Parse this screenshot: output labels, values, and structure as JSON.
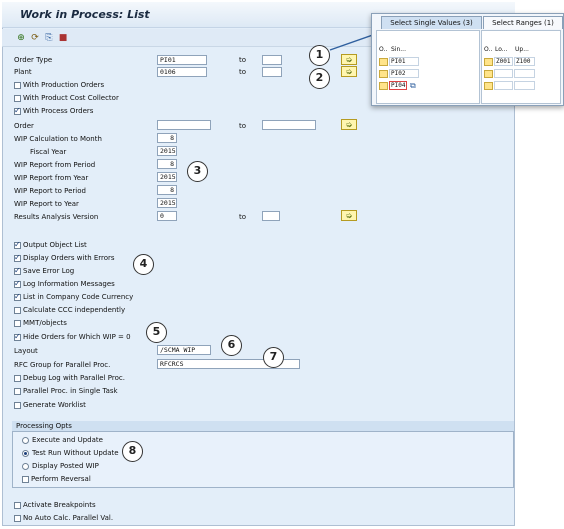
{
  "window": {
    "title": "Work in Process: List"
  },
  "toolbar": {
    "icons": [
      "execute-icon",
      "get-variant-icon",
      "save-variant-icon",
      "info-icon"
    ]
  },
  "selection": {
    "order_type": {
      "label": "Order Type",
      "from": "PI01",
      "to_label": "to",
      "to": ""
    },
    "plant": {
      "label": "Plant",
      "from": "0106",
      "to_label": "to",
      "to": ""
    },
    "with_production_orders": {
      "label": "With Production Orders",
      "checked": false
    },
    "with_product_cost_collector": {
      "label": "With Product Cost Collector",
      "checked": false
    },
    "with_process_orders": {
      "label": "With Process Orders",
      "checked": true
    },
    "order": {
      "label": "Order",
      "from": "",
      "to_label": "to",
      "to": ""
    },
    "wip_calc_month": {
      "label": "WIP Calculation to Month",
      "value": "8"
    },
    "fiscal_year": {
      "label": "Fiscal Year",
      "value": "2015"
    },
    "wip_from_period": {
      "label": "WIP Report from Period",
      "value": "8"
    },
    "wip_from_year": {
      "label": "WIP Report from Year",
      "value": "2015"
    },
    "wip_to_period": {
      "label": "WIP Report to Period",
      "value": "8"
    },
    "wip_to_year": {
      "label": "WIP Report to Year",
      "value": "2015"
    },
    "results_analysis_version": {
      "label": "Results Analysis Version",
      "value": "0",
      "to_label": "to",
      "to": ""
    }
  },
  "options": [
    {
      "label": "Output Object List",
      "checked": true
    },
    {
      "label": "Display Orders with Errors",
      "checked": true
    },
    {
      "label": "Save Error Log",
      "checked": true
    },
    {
      "label": "Log Information Messages",
      "checked": true
    },
    {
      "label": "List in Company Code Currency",
      "checked": true
    },
    {
      "label": "Calculate CCC independently",
      "checked": false
    },
    {
      "label": "MMT/objects",
      "checked": false
    },
    {
      "label": "Hide Orders for Which WIP = 0",
      "checked": true
    }
  ],
  "layout": {
    "label": "Layout",
    "value": "/SCMA WIP"
  },
  "rfc_group": {
    "label": "RFC Group for Parallel Proc.",
    "value": "RFCRCS"
  },
  "parallel_options": [
    {
      "label": "Debug Log with Parallel Proc.",
      "checked": false
    },
    {
      "label": "Parallel Proc. in Single Task",
      "checked": false
    },
    {
      "label": "Generate Worklist",
      "checked": false
    }
  ],
  "processing": {
    "title": "Processing Opts",
    "radios": [
      {
        "label": "Execute and Update",
        "selected": false
      },
      {
        "label": "Test Run Without Update",
        "selected": true
      },
      {
        "label": "Display Posted WIP",
        "selected": false
      }
    ],
    "perform_reversal": {
      "label": "Perform Reversal",
      "checked": false
    }
  },
  "bottom_options": [
    {
      "label": "Activate Breakpoints",
      "checked": false
    },
    {
      "label": "No Auto Calc. Parallel Val.",
      "checked": false
    }
  ],
  "callouts": [
    "1",
    "2",
    "3",
    "4",
    "5",
    "6",
    "7",
    "8"
  ],
  "popup": {
    "tabs": [
      "Select Single Values (3)",
      "Select Ranges (1)"
    ],
    "single": {
      "headers": [
        "O..",
        "Sin..."
      ],
      "values": [
        "PI01",
        "PI02",
        "PI04"
      ]
    },
    "ranges": {
      "headers": [
        "O..",
        "Lo...",
        "Up..."
      ],
      "rows": [
        {
          "low": "Z001",
          "high": "Z100"
        }
      ]
    }
  },
  "colors": {
    "panel": "#e3eef9",
    "accent": "#1b3f7a",
    "button_yellow": "#fff6b0",
    "annotation_arrow": "#2f5f9e"
  }
}
